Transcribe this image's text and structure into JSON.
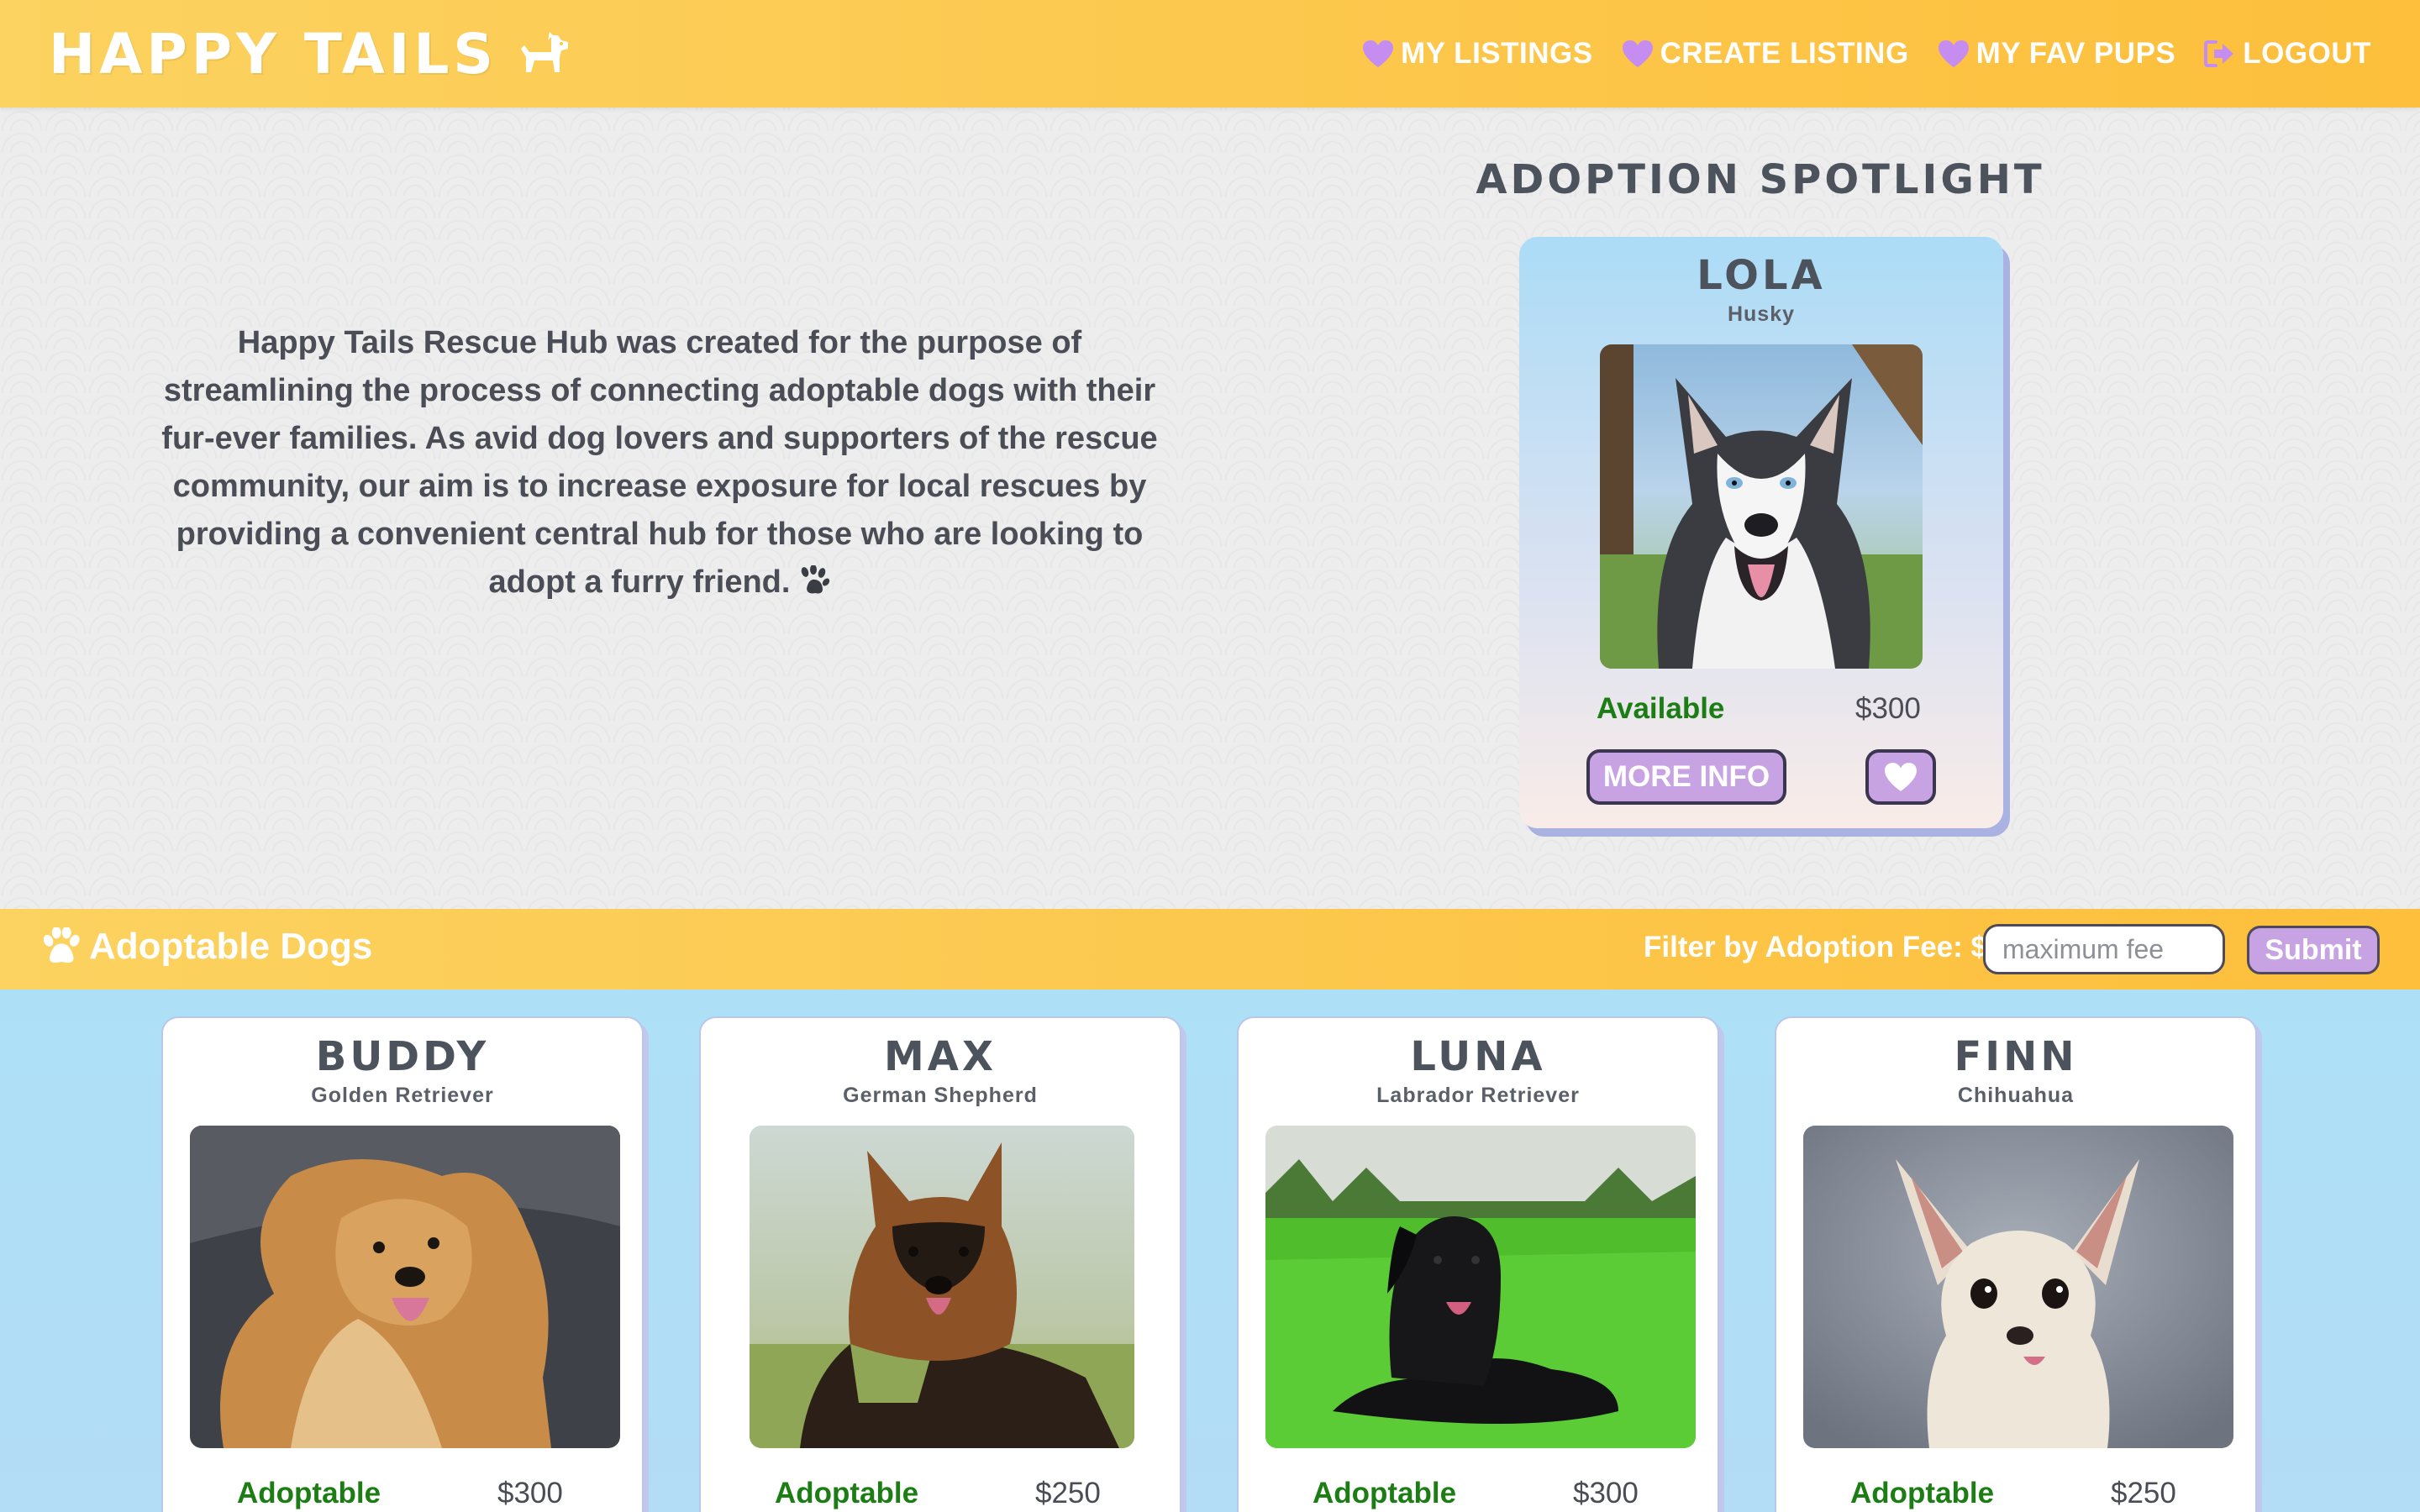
{
  "header": {
    "brand": "HAPPY TAILS",
    "nav": [
      {
        "label": "MY LISTINGS",
        "icon": "heart-icon"
      },
      {
        "label": "CREATE LISTING",
        "icon": "heart-icon"
      },
      {
        "label": "MY FAV PUPS",
        "icon": "heart-icon"
      },
      {
        "label": "LOGOUT",
        "icon": "logout-icon"
      }
    ]
  },
  "intro": {
    "text": "Happy Tails Rescue Hub was created for the purpose of streamlining the process of connecting adoptable dogs with their fur-ever families. As avid dog lovers and supporters of the rescue community, our aim is to increase exposure for local rescues by providing a convenient central hub for those who are looking to adopt a furry friend."
  },
  "spotlight": {
    "heading": "ADOPTION SPOTLIGHT",
    "name": "LOLA",
    "breed": "Husky",
    "status": "Available",
    "fee": "$300",
    "more_label": "MORE INFO"
  },
  "listing": {
    "title": "Adoptable Dogs",
    "filter_label": "Filter by Adoption Fee: $",
    "filter_placeholder": "maximum fee",
    "submit_label": "Submit"
  },
  "dogs": [
    {
      "name": "BUDDY",
      "breed": "Golden Retriever",
      "status": "Adoptable",
      "fee": "$300"
    },
    {
      "name": "MAX",
      "breed": "German Shepherd",
      "status": "Adoptable",
      "fee": "$250"
    },
    {
      "name": "LUNA",
      "breed": "Labrador Retriever",
      "status": "Adoptable",
      "fee": "$300"
    },
    {
      "name": "FINN",
      "breed": "Chihuahua",
      "status": "Adoptable",
      "fee": "$250"
    }
  ],
  "colors": {
    "header": "#fdc848",
    "accent": "#c7a3e3",
    "status_green": "#1b7d14",
    "grid_bg": "#ade0f7"
  }
}
